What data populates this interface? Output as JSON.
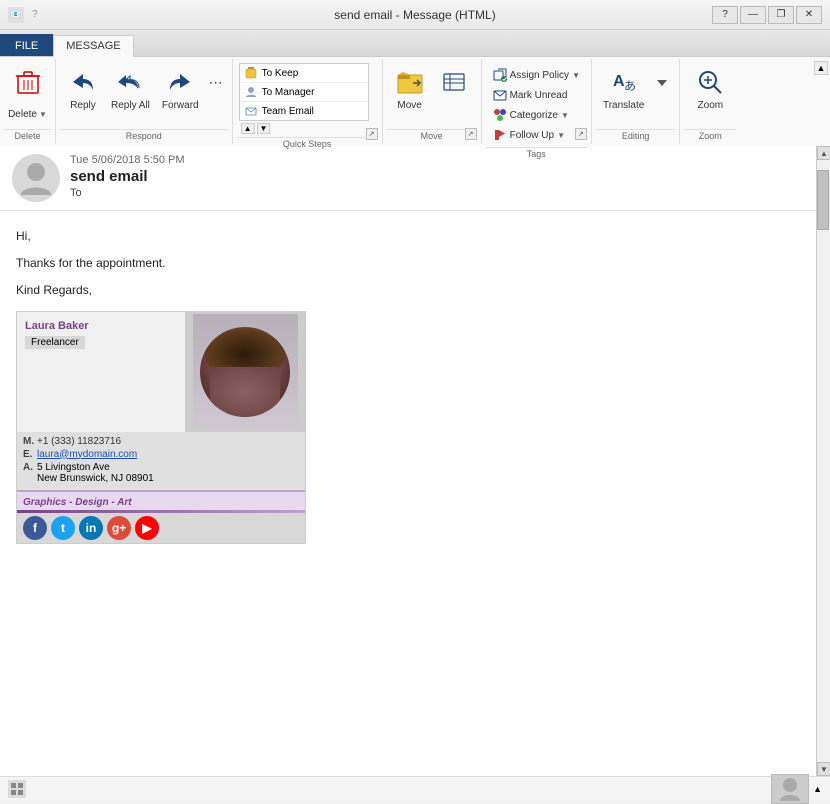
{
  "window": {
    "title": "send email - Message (HTML)",
    "help": "?",
    "minimize": "—",
    "restore": "❐",
    "close": "✕"
  },
  "ribbon": {
    "tabs": [
      {
        "id": "file",
        "label": "FILE",
        "active": false
      },
      {
        "id": "message",
        "label": "MESSAGE",
        "active": true
      }
    ],
    "groups": {
      "delete": {
        "label": "Delete",
        "buttons": [
          {
            "id": "delete",
            "label": "Delete",
            "icon": "✕"
          }
        ]
      },
      "respond": {
        "label": "Respond",
        "buttons": [
          {
            "id": "reply",
            "label": "Reply",
            "icon": "↩"
          },
          {
            "id": "reply-all",
            "label": "Reply All",
            "icon": "↩↩"
          },
          {
            "id": "forward",
            "label": "Forward",
            "icon": "→"
          }
        ]
      },
      "quicksteps": {
        "label": "Quick Steps",
        "items": [
          {
            "id": "to-keep",
            "label": "To Keep",
            "icon": "📁"
          },
          {
            "id": "to-manager",
            "label": "To Manager",
            "icon": "👤"
          },
          {
            "id": "team-email",
            "label": "Team Email",
            "icon": "👥"
          }
        ]
      },
      "move": {
        "label": "Move",
        "buttons": [
          {
            "id": "move",
            "label": "Move",
            "icon": "📂"
          }
        ]
      },
      "tags": {
        "label": "Tags",
        "buttons": [
          {
            "id": "assign-policy",
            "label": "Assign Policy",
            "icon": "🏷"
          },
          {
            "id": "mark-unread",
            "label": "Mark Unread",
            "icon": "✉"
          },
          {
            "id": "categorize",
            "label": "Categorize",
            "icon": "🏷"
          },
          {
            "id": "follow-up",
            "label": "Follow Up",
            "icon": "🚩"
          }
        ]
      },
      "editing": {
        "label": "Editing",
        "buttons": [
          {
            "id": "translate",
            "label": "Translate",
            "icon": "T"
          }
        ]
      },
      "zoom": {
        "label": "Zoom",
        "buttons": [
          {
            "id": "zoom",
            "label": "Zoom",
            "icon": "🔍"
          }
        ]
      }
    }
  },
  "email": {
    "date": "Tue 5/06/2018 5:50 PM",
    "subject": "send email",
    "to_label": "To",
    "to_value": "",
    "greeting": "Hi,",
    "body_line1": "Thanks for the appointment.",
    "body_line2": "",
    "closing": "Kind Regards,"
  },
  "signature": {
    "name": "Laura Baker",
    "title": "Freelancer",
    "phone_label": "M.",
    "phone": "+1 (333) 11823716",
    "email_label": "E.",
    "email": "laura@mydomain.com",
    "address_label": "A.",
    "address_line1": "5 Livingston Ave",
    "address_line2": "New Brunswick, NJ 08901",
    "tagline": "Graphics - Design - Art",
    "social": {
      "facebook": "f",
      "twitter": "t",
      "linkedin": "in",
      "googleplus": "g+",
      "youtube": "▶"
    }
  },
  "status_bar": {
    "icon_label": "status-icon"
  }
}
